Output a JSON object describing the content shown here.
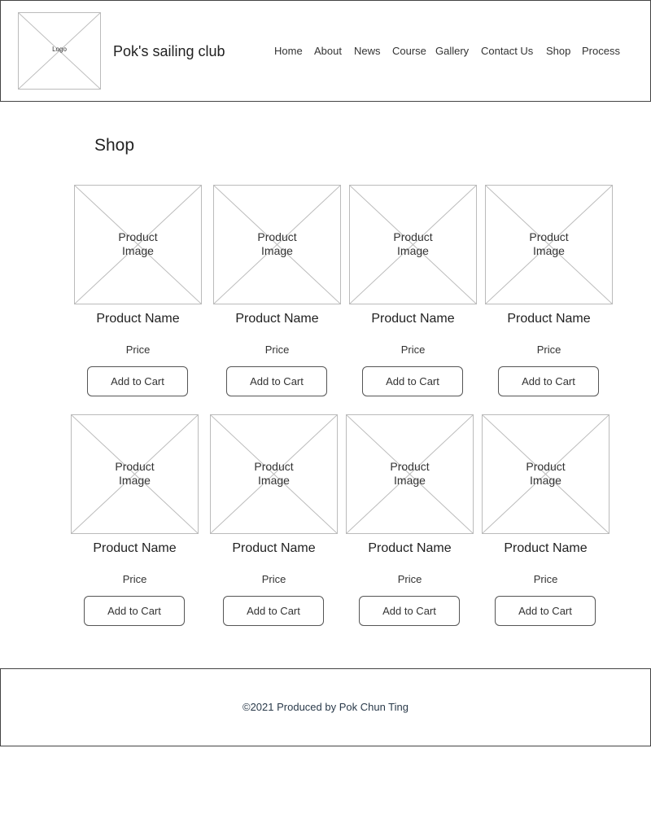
{
  "header": {
    "logo_label": "Logo",
    "site_title": "Pok's sailing club",
    "nav": [
      {
        "label": "Home"
      },
      {
        "label": "About"
      },
      {
        "label": "News"
      },
      {
        "label": "Course"
      },
      {
        "label": "Gallery"
      },
      {
        "label": "Contact Us"
      },
      {
        "label": "Shop"
      },
      {
        "label": "Process"
      }
    ]
  },
  "main": {
    "title": "Shop",
    "image_placeholder": "Product Image",
    "products": [
      {
        "name": "Product Name",
        "price": "Price",
        "button": "Add to Cart"
      },
      {
        "name": "Product Name",
        "price": "Price",
        "button": "Add to Cart"
      },
      {
        "name": "Product Name",
        "price": "Price",
        "button": "Add to Cart"
      },
      {
        "name": "Product Name",
        "price": "Price",
        "button": "Add to Cart"
      },
      {
        "name": "Product Name",
        "price": "Price",
        "button": "Add to Cart"
      },
      {
        "name": "Product Name",
        "price": "Price",
        "button": "Add to Cart"
      },
      {
        "name": "Product Name",
        "price": "Price",
        "button": "Add to Cart"
      },
      {
        "name": "Product Name",
        "price": "Price",
        "button": "Add to Cart"
      }
    ]
  },
  "footer": {
    "copyright": "©2021 Produced by Pok Chun Ting"
  }
}
